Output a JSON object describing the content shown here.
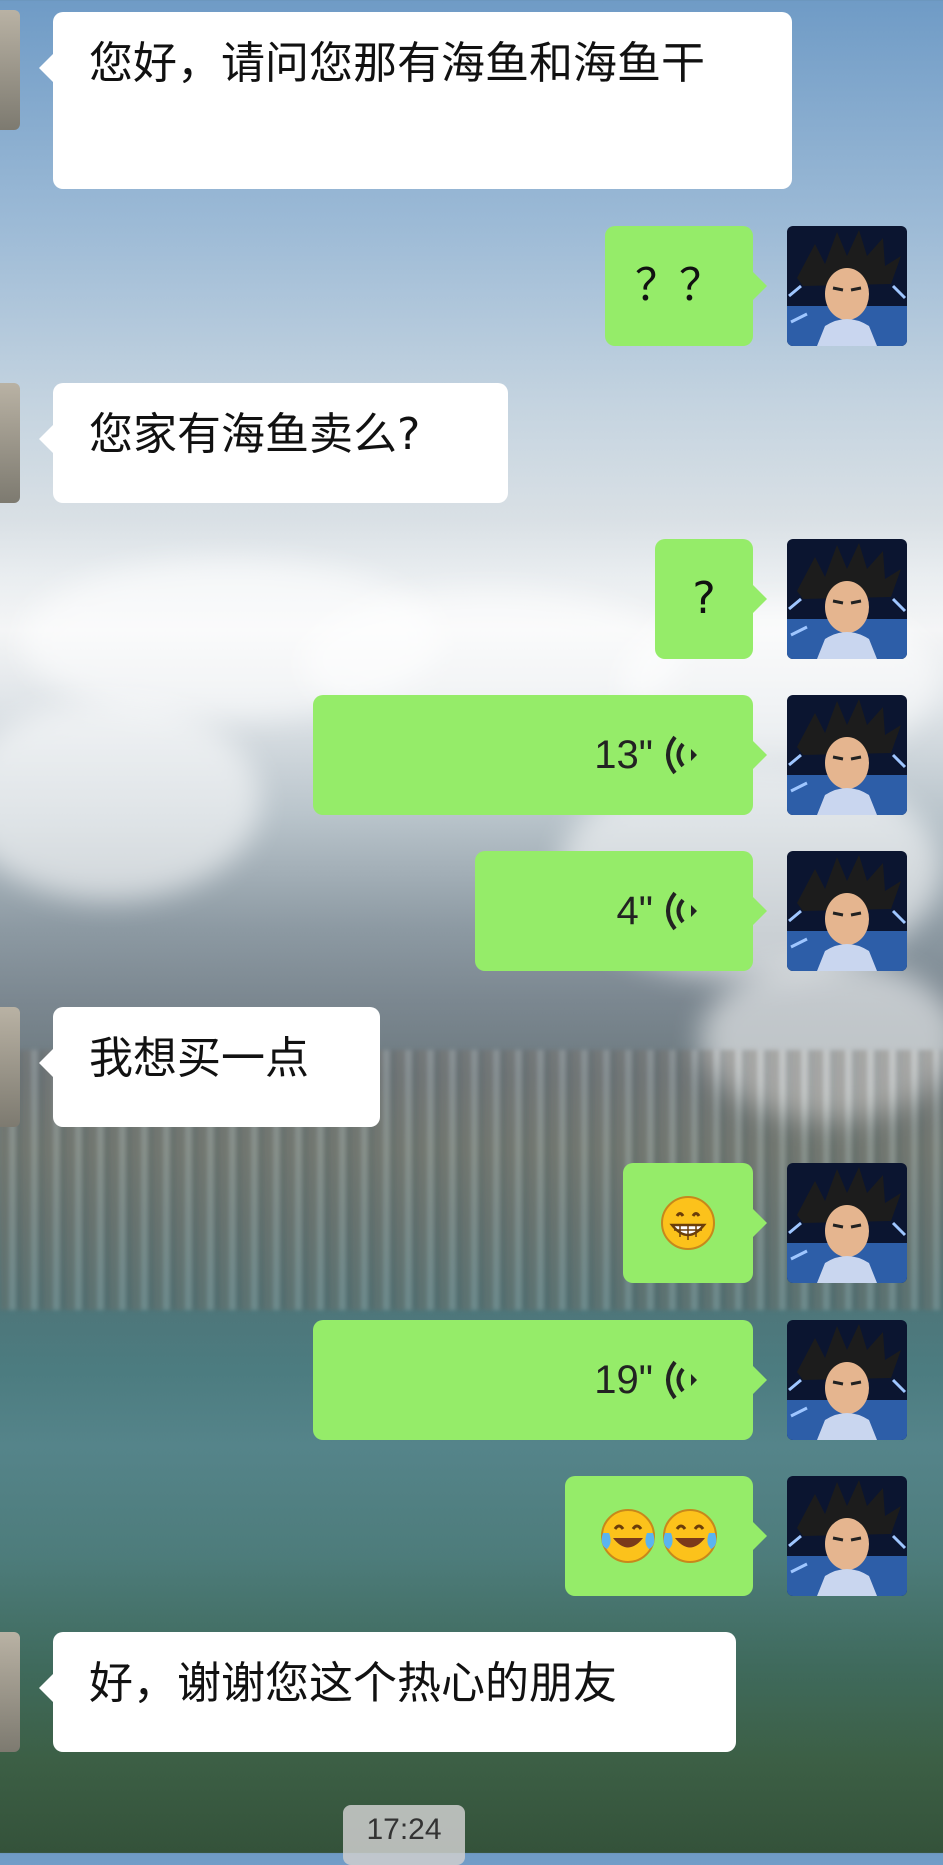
{
  "chat": {
    "messages": [
      {
        "side": "left",
        "text": "您好，请问您那有海鱼和海鱼干"
      },
      {
        "side": "right",
        "text": "？？"
      },
      {
        "side": "left",
        "text": "您家有海鱼卖么?"
      },
      {
        "side": "right",
        "text": "?"
      },
      {
        "side": "right",
        "type": "voice",
        "duration": "13\""
      },
      {
        "side": "right",
        "type": "voice",
        "duration": "4\""
      },
      {
        "side": "left",
        "text": "我想买一点"
      },
      {
        "side": "right",
        "type": "emoji",
        "emoji": "grinning-face"
      },
      {
        "side": "right",
        "type": "voice",
        "duration": "19\""
      },
      {
        "side": "right",
        "type": "emoji",
        "emoji": "tears-of-joy x2"
      },
      {
        "side": "left",
        "text": "好，谢谢您这个热心的朋友"
      }
    ],
    "timestamp": "17:24"
  },
  "colors": {
    "outgoing_bubble": "#95ec69",
    "incoming_bubble": "#ffffff"
  }
}
